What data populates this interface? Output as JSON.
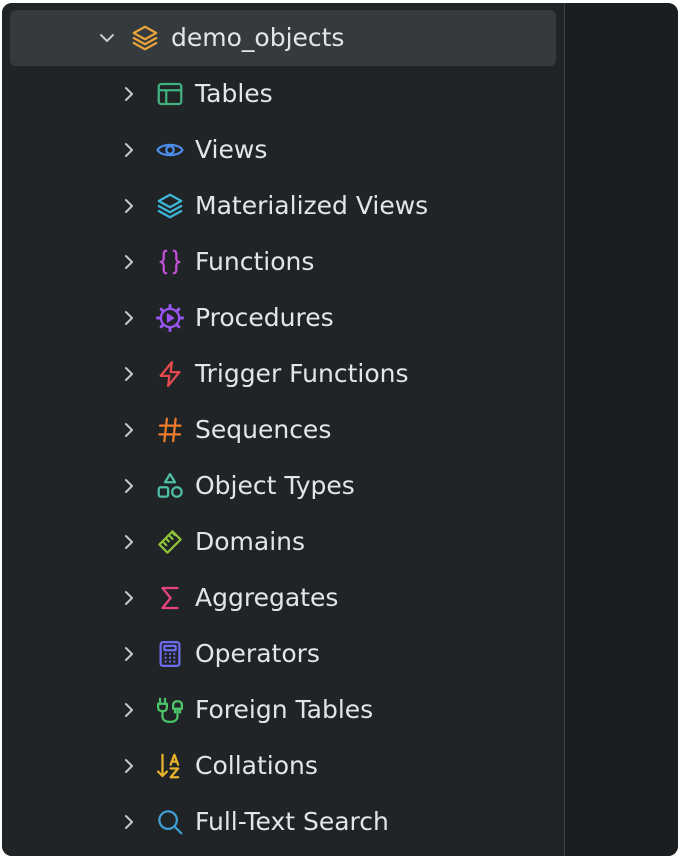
{
  "tree": {
    "root": {
      "label": "demo_objects",
      "icon": "layers-icon",
      "icon_color": "#e8a33a",
      "expanded": true
    },
    "children": [
      {
        "label": "Tables",
        "icon": "table-icon",
        "color": "#3fb27f"
      },
      {
        "label": "Views",
        "icon": "eye-icon",
        "color": "#4c8dea"
      },
      {
        "label": "Materialized Views",
        "icon": "stack-icon",
        "color": "#3fb6d9"
      },
      {
        "label": "Functions",
        "icon": "braces-icon",
        "color": "#c44fd8"
      },
      {
        "label": "Procedures",
        "icon": "gear-play-icon",
        "color": "#9a55f2"
      },
      {
        "label": "Trigger Functions",
        "icon": "lightning-icon",
        "color": "#e5484d"
      },
      {
        "label": "Sequences",
        "icon": "hash-icon",
        "color": "#f07a2b"
      },
      {
        "label": "Object Types",
        "icon": "shapes-icon",
        "color": "#4fbfa8"
      },
      {
        "label": "Domains",
        "icon": "ruler-icon",
        "color": "#8fc33a"
      },
      {
        "label": "Aggregates",
        "icon": "sigma-icon",
        "color": "#e8457e"
      },
      {
        "label": "Operators",
        "icon": "calculator-icon",
        "color": "#6b6cf0"
      },
      {
        "label": "Foreign Tables",
        "icon": "plug-icon",
        "color": "#4cc46a"
      },
      {
        "label": "Collations",
        "icon": "sort-az-icon",
        "color": "#e8b22c"
      },
      {
        "label": "Full-Text Search",
        "icon": "search-icon",
        "color": "#3f9fd0"
      }
    ]
  }
}
